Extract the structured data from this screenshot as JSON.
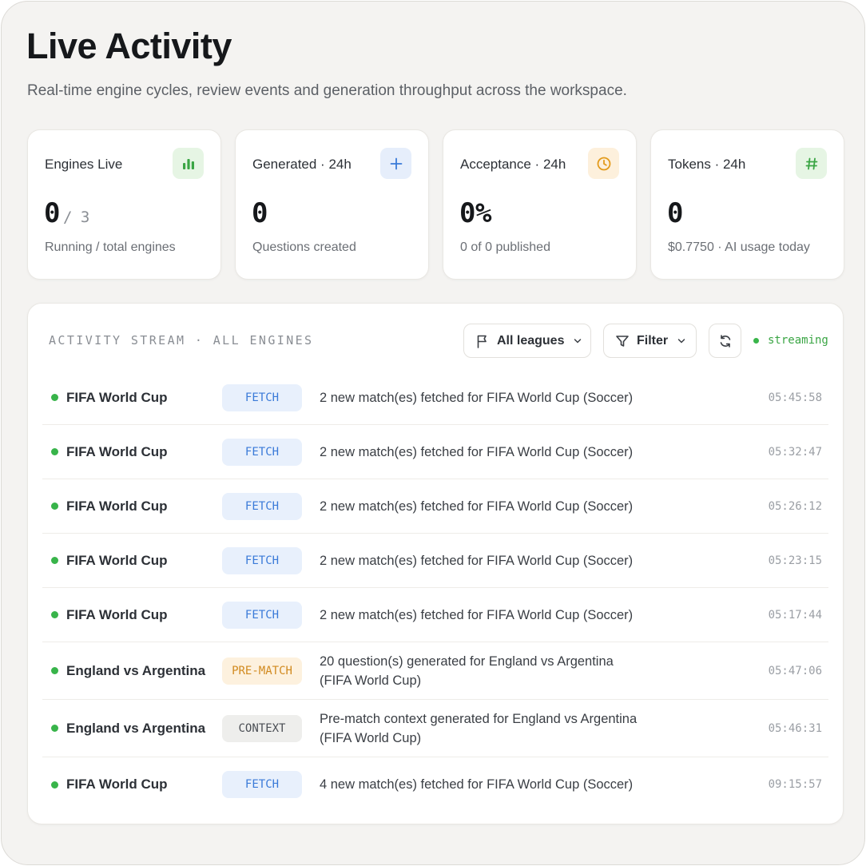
{
  "page": {
    "title": "Live Activity",
    "subtitle": "Real-time engine cycles, review events and generation throughput across the workspace."
  },
  "stats": [
    {
      "label": "Engines Live",
      "value": "0",
      "total": "/ 3",
      "caption": "Running / total engines",
      "icon": "bar-chart-icon",
      "icon_color": "#3aa544",
      "icon_bg": "#e6f5e4"
    },
    {
      "label": "Generated · 24h",
      "value": "0",
      "caption": "Questions created",
      "icon": "plus-icon",
      "icon_color": "#3a7ad8",
      "icon_bg": "#e6eefb"
    },
    {
      "label": "Acceptance · 24h",
      "value": "0%",
      "caption": "0 of 0 published",
      "icon": "clock-icon",
      "icon_color": "#e39b1c",
      "icon_bg": "#fdf0dc"
    },
    {
      "label": "Tokens · 24h",
      "value": "0",
      "caption": "$0.7750 · AI usage today",
      "icon": "hash-icon",
      "icon_color": "#3aa544",
      "icon_bg": "#e6f5e4"
    }
  ],
  "stream": {
    "title": "ACTIVITY STREAM · ALL ENGINES",
    "leagues_label": "All leagues",
    "filter_label": "Filter",
    "status": "streaming",
    "status_color": "#39b54a",
    "rows": [
      {
        "source": "FIFA World Cup",
        "tag": "FETCH",
        "tag_type": "fetch",
        "message": "2 new match(es) fetched for FIFA World Cup (Soccer)",
        "time": "05:45:58"
      },
      {
        "source": "FIFA World Cup",
        "tag": "FETCH",
        "tag_type": "fetch",
        "message": "2 new match(es) fetched for FIFA World Cup (Soccer)",
        "time": "05:32:47"
      },
      {
        "source": "FIFA World Cup",
        "tag": "FETCH",
        "tag_type": "fetch",
        "message": "2 new match(es) fetched for FIFA World Cup (Soccer)",
        "time": "05:26:12"
      },
      {
        "source": "FIFA World Cup",
        "tag": "FETCH",
        "tag_type": "fetch",
        "message": "2 new match(es) fetched for FIFA World Cup (Soccer)",
        "time": "05:23:15"
      },
      {
        "source": "FIFA World Cup",
        "tag": "FETCH",
        "tag_type": "fetch",
        "message": "2 new match(es) fetched for FIFA World Cup (Soccer)",
        "time": "05:17:44"
      },
      {
        "source": "England vs Argentina",
        "tag": "PRE-MATCH",
        "tag_type": "prematch",
        "message": "20 question(s) generated for England vs Argentina (FIFA World Cup)",
        "time": "05:47:06"
      },
      {
        "source": "England vs Argentina",
        "tag": "CONTEXT",
        "tag_type": "context",
        "message": "Pre-match context generated for England vs Argentina (FIFA World Cup)",
        "time": "05:46:31"
      },
      {
        "source": "FIFA World Cup",
        "tag": "FETCH",
        "tag_type": "fetch",
        "message": "4 new match(es) fetched for FIFA World Cup (Soccer)",
        "time": "09:15:57"
      }
    ]
  }
}
